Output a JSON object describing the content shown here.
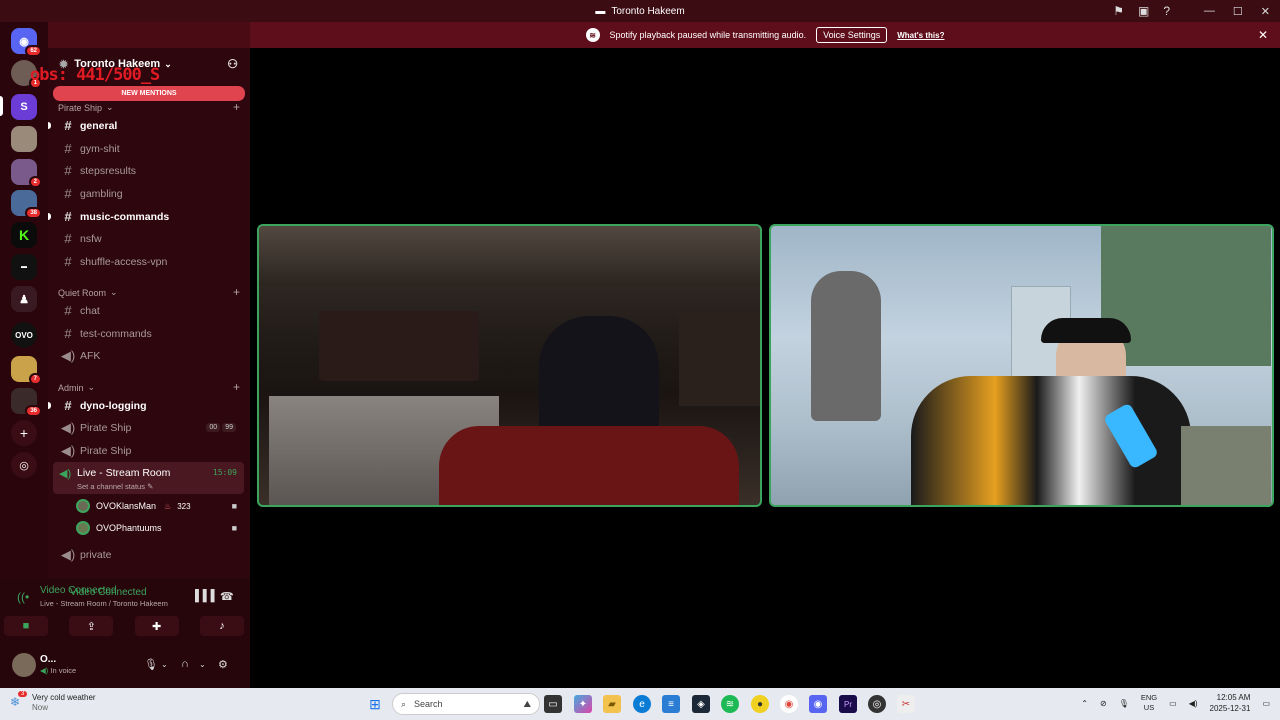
{
  "window": {
    "title": "Toronto Hakeem"
  },
  "notice": {
    "text": "Spotify playback paused while transmitting audio.",
    "button": "Voice Settings",
    "link": "What's this?"
  },
  "rail": {
    "home_badge": "62",
    "badges": [
      "1",
      "2",
      "38",
      "7",
      "36"
    ],
    "letters": {
      "k": "K",
      "ovo": "OVO"
    }
  },
  "server": {
    "name": "Toronto Hakeem",
    "overlay": "obs: 441/500_S",
    "new_mentions": "NEW MENTIONS"
  },
  "categories": {
    "pirate": "Pirate Ship",
    "quiet": "Quiet Room",
    "admin": "Admin"
  },
  "channels": {
    "general": "general",
    "gym": "gym-shit",
    "steps": "stepsresults",
    "gambling": "gambling",
    "music": "music-commands",
    "nsfw": "nsfw",
    "shuffle": "shuffle-access-vpn",
    "chat": "chat",
    "test": "test-commands",
    "afk": "AFK",
    "dyno": "dyno-logging",
    "pirate1": "Pirate Ship",
    "pirate1_counts": [
      "00",
      "99"
    ],
    "pirate2": "Pirate Ship",
    "live": "Live - Stream Room",
    "live_status": "Set a channel status",
    "live_timer": "15:09",
    "private": "private"
  },
  "voice_users": [
    {
      "name": "OVOKlansMan",
      "boost": "323"
    },
    {
      "name": "OVOPhantuums",
      "boost": ""
    }
  ],
  "voice_panel": {
    "status": "Video Connected",
    "location": "Live - Stream Room / Toronto Hakeem"
  },
  "user_panel": {
    "name": "O...",
    "status": "In voice"
  },
  "taskbar": {
    "weather_badge": "3",
    "weather_title": "Very cold weather",
    "weather_sub": "Now",
    "search_placeholder": "Search",
    "lang_top": "ENG",
    "lang_bottom": "US",
    "time": "12:05 AM",
    "date": "2025-12-31"
  },
  "colors": {
    "accent_green": "#3ba55d",
    "banner": "#5e0d1a",
    "sidebar": "#2e060d",
    "mentions": "#e0444f"
  }
}
